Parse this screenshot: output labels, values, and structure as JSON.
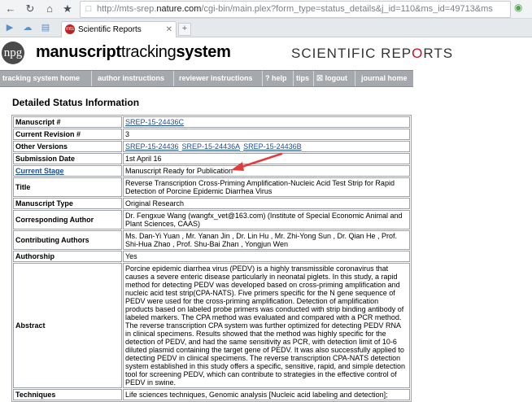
{
  "browser": {
    "url_prefix": "http://mts-srep.",
    "url_domain": "nature.com",
    "url_suffix": "/cgi-bin/main.plex?form_type=status_details&j_id=110&ms_id=49713&ms",
    "tab_title": "Scientific Reports",
    "tab_favicon": "mts"
  },
  "header": {
    "npg": "npg",
    "title_part1": "manuscript",
    "title_part2": "tracking",
    "title_part3": "system",
    "sr_part1": "SCIENTIFIC REP",
    "sr_part2": "O",
    "sr_part3": "RTS"
  },
  "nav": {
    "items": [
      {
        "label": "tracking system home"
      },
      {
        "label": "author instructions"
      },
      {
        "label": "reviewer instructions"
      },
      {
        "label": "? help"
      },
      {
        "label": "tips"
      },
      {
        "label": "☒ logout"
      },
      {
        "label": "journal home"
      }
    ]
  },
  "page": {
    "heading": "Detailed Status Information"
  },
  "details": {
    "manuscript_label": "Manuscript #",
    "manuscript_value": "SREP-15-24436C",
    "revision_label": "Current Revision #",
    "revision_value": "3",
    "other_versions_label": "Other Versions",
    "other_versions": [
      "SREP-15-24436",
      "SREP-15-24436A",
      "SREP-15-24436B"
    ],
    "submission_label": "Submission Date",
    "submission_value": "1st April 16",
    "stage_label": "Current Stage",
    "stage_value": "Manuscript Ready for Publication",
    "title_label": "Title",
    "title_value": "Reverse Transcription Cross-Priming Amplification-Nucleic Acid Test Strip for Rapid Detection of Porcine Epidemic Diarrhea Virus",
    "type_label": "Manuscript Type",
    "type_value": "Original Research",
    "corresponding_label": "Corresponding Author",
    "corresponding_value": "Dr. Fengxue Wang (wangfx_vet@163.com) (Institute of Special Economic Animal and Plant Sciences, CAAS)",
    "contributing_label": "Contributing Authors",
    "contributing_value": "Ms. Dan-Yi Yuan , Mr. Yanan Jin , Dr. Lin Hu , Mr. Zhi-Yong Sun , Dr. Qian He , Prof. Shi-Hua Zhao , Prof. Shu-Bai Zhan , Yongjun Wen",
    "authorship_label": "Authorship",
    "authorship_value": "Yes",
    "abstract_label": "Abstract",
    "abstract_value": "Porcine epidemic diarrhea virus (PEDV) is a highly transmissible coronavirus that causes a severe enteric disease particularly in neonatal piglets. In this study, a rapid method for detecting PEDV was developed based on cross-priming amplification and nucleic acid test strip(CPA-NATS). Five primers specific for the N gene sequence of PEDV were used for the cross-priming amplification. Detection of amplification products based on labeled probe primers was conducted with strip binding antibody of labeled markers. The CPA method was evaluated and compared with a PCR method. The reverse transcription CPA system was further optimized for detecting PEDV RNA in clinical specimens. Results showed that the method was highly specific for the detection of PEDV, and had the same sensitivity as PCR, with detection limit of 10-6 diluted plasmid containing the target gene of PEDV. It was also successfully applied to detecting PEDV in clinical specimens. The reverse transcription CPA-NATS detection system established in this study offers a specific, sensitive, rapid, and simple detection tool for screening PEDV, which can contribute to strategies in the effective control of PEDV in swine.",
    "techniques_label": "Techniques",
    "techniques_value": "Life sciences techniques, Genomic analysis [Nucleic acid labeling and detection];"
  },
  "colors": {
    "nav_bg": "#a5a8ac",
    "link": "#1a4e9c",
    "brand_red": "#c8102e",
    "annotation_arrow": "#e23b3b"
  }
}
